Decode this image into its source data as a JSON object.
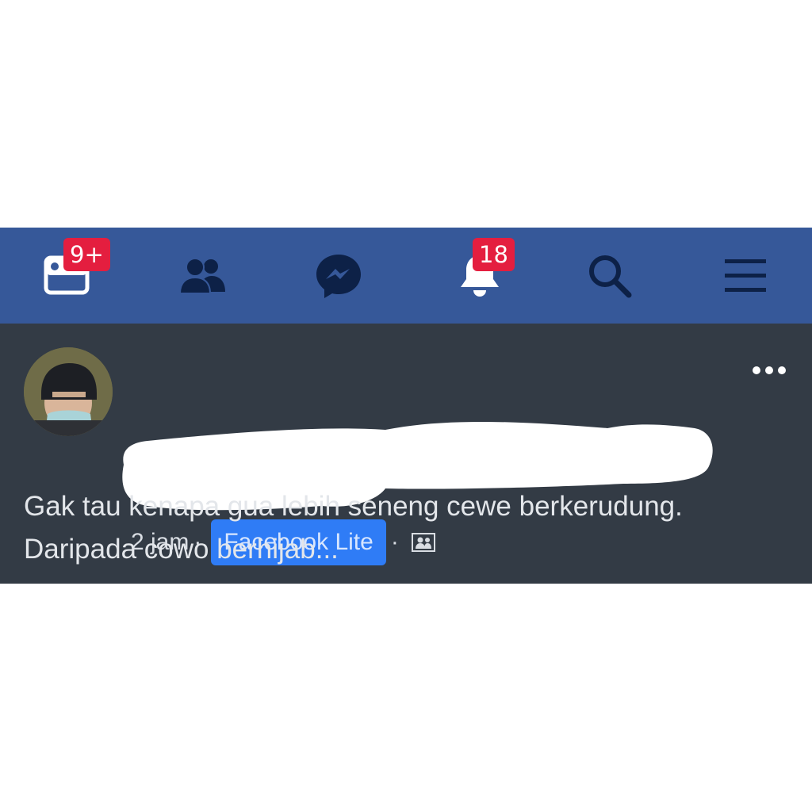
{
  "navbar": {
    "items": [
      {
        "name": "news-feed",
        "icon": "news-feed-icon",
        "badge": "9+"
      },
      {
        "name": "friends",
        "icon": "friends-icon",
        "badge": ""
      },
      {
        "name": "messenger",
        "icon": "messenger-icon",
        "badge": ""
      },
      {
        "name": "notifications",
        "icon": "bell-icon",
        "badge": "18"
      },
      {
        "name": "search",
        "icon": "search-icon",
        "badge": ""
      },
      {
        "name": "menu",
        "icon": "hamburger-menu-icon",
        "badge": ""
      }
    ],
    "colors": {
      "background": "#365899",
      "icon": "#0d2147",
      "badge": "#e41e3f"
    }
  },
  "post": {
    "author_name_redacted": true,
    "time": "2 jam",
    "separator": "·",
    "source": "Facebook Lite",
    "audience_icon": "friends-audience-icon",
    "text_line_1": "Gak tau kenapa gua lebih seneng cewe berkerudung.",
    "text_line_2": "Daripada cowo berhijab...",
    "colors": {
      "background": "#333b45",
      "source_link_bg": "#2f7cf6"
    }
  }
}
